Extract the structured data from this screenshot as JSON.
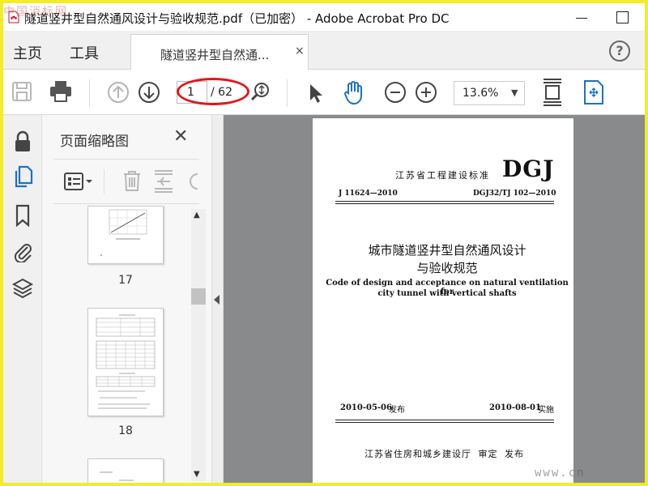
{
  "window": {
    "title": "隧道竖井型自然通风设计与验收规范.pdf（已加密） - Adobe Acrobat Pro DC",
    "watermark_top": "中国消标网",
    "watermark_bottom": "www.cn"
  },
  "nav": {
    "home_label": "主页",
    "tools_label": "工具",
    "doc_tab_label": "隧道竖井型自然通...",
    "doc_tab_close": "×",
    "help": "?"
  },
  "toolbar": {
    "page_current": "1",
    "page_total": "/ 62",
    "zoom": "13.6%",
    "zoom_arrow": "▼"
  },
  "panel": {
    "title": "页面缩略图",
    "close": "✕",
    "thumbnails": [
      {
        "label": "17"
      },
      {
        "label": "18"
      }
    ],
    "scroll_up": "▲",
    "scroll_down": "▼"
  },
  "page": {
    "org": "江苏省工程建设标准",
    "series": "DGJ",
    "code_left": "J 11624—2010",
    "code_right": "DGJ32/TJ 102—2010",
    "title_cn_1": "城市隧道竖井型自然通风设计",
    "title_cn_2": "与验收规范",
    "title_en_1": "Code of design and acceptance on natural ventilation for",
    "title_en_2": "city tunnel with vertical shafts",
    "issue_date": "2010-05-06",
    "issue_suffix": "发布",
    "effective_date": "2010-08-01",
    "effective_suffix": "实施",
    "issuer": "江苏省住房和城乡建设厅 审定 发布"
  },
  "colors": {
    "frame_border": "#f4ec28",
    "accent_blue": "#1a73c8",
    "highlight_red": "#e01818",
    "doc_background": "#888a8c"
  },
  "icons": {
    "rail": [
      "lock-icon",
      "pages-icon",
      "bookmark-icon",
      "attachment-icon",
      "layers-icon"
    ],
    "toolbar": [
      "save-icon",
      "print-icon",
      "page-up-icon",
      "page-down-icon",
      "zoom-search-icon",
      "select-cursor-icon",
      "hand-icon",
      "zoom-out-icon",
      "zoom-in-icon",
      "fit-page-icon",
      "full-screen-icon"
    ]
  }
}
